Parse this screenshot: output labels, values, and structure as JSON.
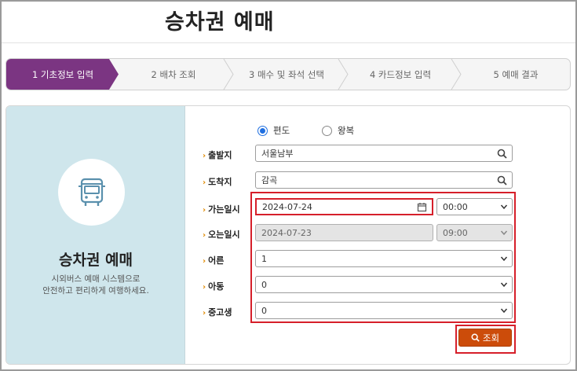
{
  "page": {
    "title": "승차권 예매"
  },
  "steps": [
    {
      "label": "1 기초정보 입력",
      "active": true
    },
    {
      "label": "2 배차 조회",
      "active": false
    },
    {
      "label": "3 매수 및 좌석 선택",
      "active": false
    },
    {
      "label": "4 카드정보 입력",
      "active": false
    },
    {
      "label": "5 예매 결과",
      "active": false
    }
  ],
  "intro": {
    "icon": "bus-icon",
    "title": "승차권 예매",
    "desc_line1": "시외버스 예매 시스템으로",
    "desc_line2": "안전하고 편리하게 여행하세요."
  },
  "trip_type": {
    "one_way": "편도",
    "round_trip": "왕복",
    "selected": "편도"
  },
  "form": {
    "departure": {
      "label": "출발지",
      "value": "서울남부"
    },
    "arrival": {
      "label": "도착지",
      "value": "감곡"
    },
    "go": {
      "label": "가는일시",
      "date": "2024-07-24",
      "time": "00:00"
    },
    "return": {
      "label": "오는일시",
      "date": "2024-07-23",
      "time": "09:00"
    },
    "adult": {
      "label": "어른",
      "value": "1"
    },
    "child": {
      "label": "아동",
      "value": "0"
    },
    "student": {
      "label": "중고생",
      "value": "0"
    }
  },
  "search_button": {
    "label": "조회"
  },
  "colors": {
    "accent": "#7b3582",
    "button": "#cc4c0a",
    "highlight": "#d61f2a",
    "panel": "#cfe6ec"
  }
}
